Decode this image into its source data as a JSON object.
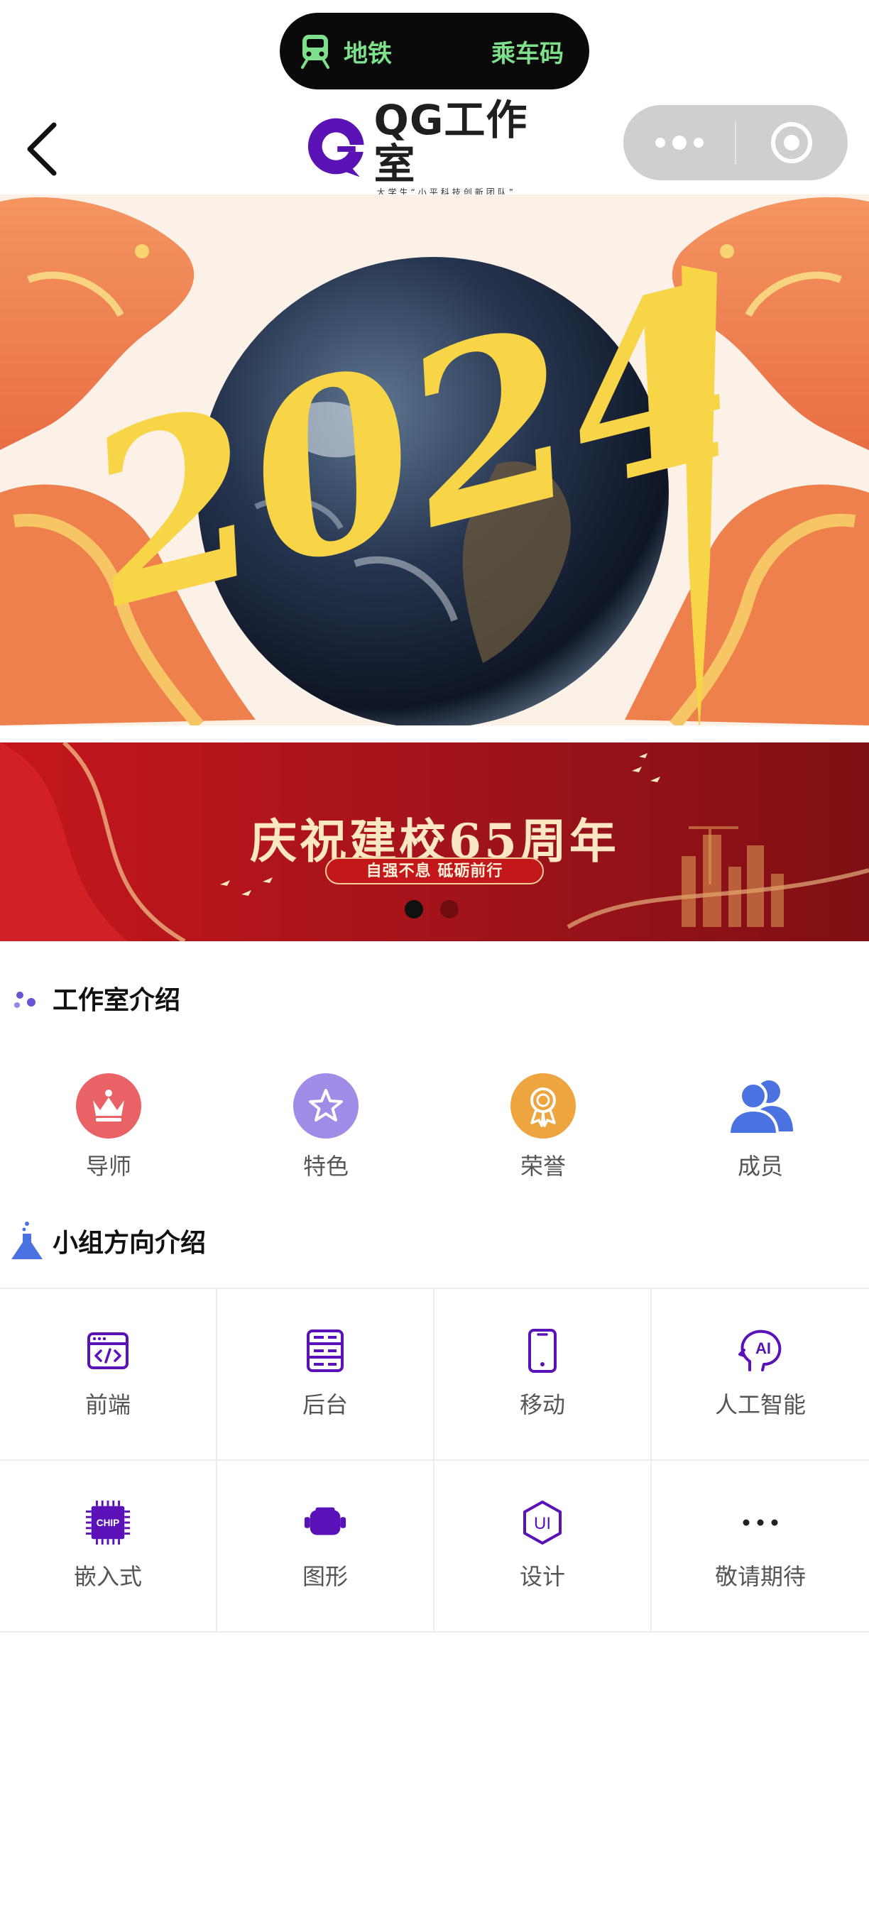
{
  "status_pill": {
    "left_label": "地铁",
    "right_label": "乘车码",
    "accent_color": "#7ee08a"
  },
  "navbar": {
    "logo_title": "QG工作室",
    "logo_subtitle": "大学生“小平科技创新团队”",
    "back_icon": "chevron-left-icon",
    "menu_icon": "more-dots-icon",
    "close_icon": "target-circle-icon"
  },
  "hero": {
    "year_text": "2024"
  },
  "banner": {
    "title": "庆祝建校65周年",
    "slogan": "自强不息 砥砺前行",
    "page_count": 2,
    "active_page": 1
  },
  "studio_section": {
    "title": "工作室介绍",
    "items": [
      {
        "label": "导师",
        "icon": "crown-icon",
        "color": "#e96265"
      },
      {
        "label": "特色",
        "icon": "star-icon",
        "color": "#a08be6"
      },
      {
        "label": "荣誉",
        "icon": "medal-icon",
        "color": "#eea43f"
      },
      {
        "label": "成员",
        "icon": "users-icon",
        "color": "#4a72e0"
      }
    ]
  },
  "group_section": {
    "title": "小组方向介绍",
    "accent_color": "#5a12b8",
    "items": [
      {
        "label": "前端",
        "icon": "code-window-icon"
      },
      {
        "label": "后台",
        "icon": "server-icon"
      },
      {
        "label": "移动",
        "icon": "phone-icon"
      },
      {
        "label": "人工智能",
        "icon": "ai-head-icon",
        "icon_text": "AI"
      },
      {
        "label": "嵌入式",
        "icon": "chip-icon",
        "icon_text": "CHIP"
      },
      {
        "label": "图形",
        "icon": "vr-headset-icon"
      },
      {
        "label": "设计",
        "icon": "ui-badge-icon",
        "icon_text": "UI"
      },
      {
        "label": "敬请期待",
        "icon": "ellipsis-icon"
      }
    ]
  }
}
